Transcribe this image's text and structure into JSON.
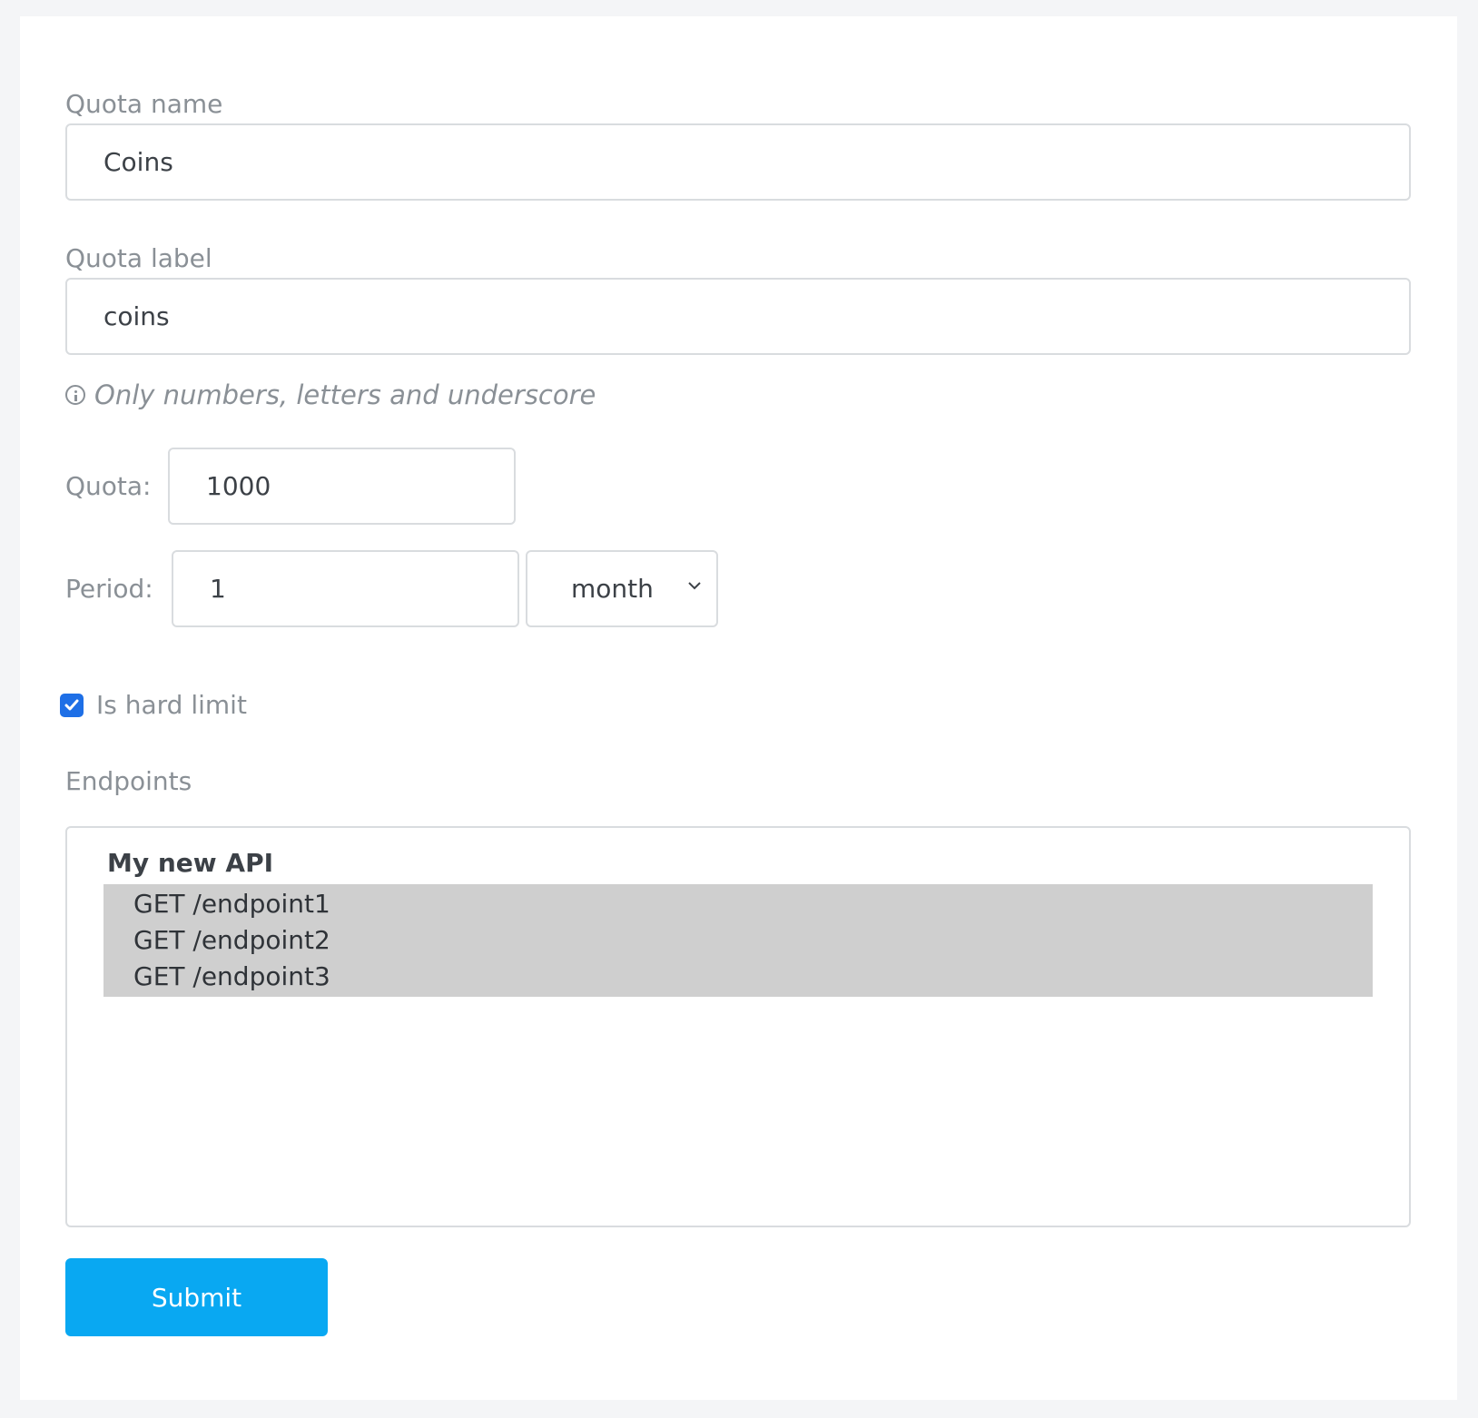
{
  "form": {
    "quota_name": {
      "label": "Quota name",
      "value": "Coins"
    },
    "quota_label": {
      "label": "Quota label",
      "value": "coins",
      "hint": "Only numbers, letters and underscore"
    },
    "quota": {
      "label": "Quota:",
      "value": "1000"
    },
    "period": {
      "label": "Period:",
      "value": "1",
      "unit": "month"
    },
    "hard_limit": {
      "label": "Is hard limit",
      "checked": true
    },
    "endpoints": {
      "label": "Endpoints",
      "group": "My new API",
      "items": [
        "GET /endpoint1",
        "GET /endpoint2",
        "GET /endpoint3"
      ]
    },
    "submit_label": "Submit"
  },
  "colors": {
    "accent": "#09a8f2",
    "checkbox": "#1e6fe6",
    "selection": "#cfcfcf"
  }
}
